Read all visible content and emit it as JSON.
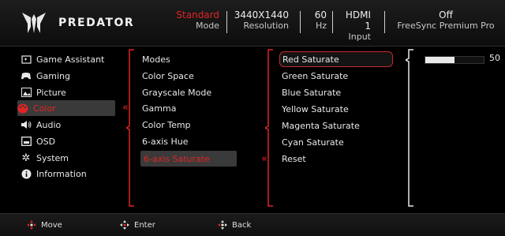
{
  "brand": {
    "name": "PREDATOR"
  },
  "status": {
    "mode": {
      "value": "Standard",
      "label": "Mode"
    },
    "resolution": {
      "value": "3440X1440",
      "label": "Resolution"
    },
    "refresh": {
      "value": "60",
      "label": "Hz"
    },
    "input": {
      "value": "HDMI 1",
      "label": "Input"
    },
    "freesync": {
      "value": "Off",
      "label": "FreeSync Premium Pro"
    }
  },
  "menu": [
    {
      "label": "Game Assistant",
      "icon": "game-assistant-icon"
    },
    {
      "label": "Gaming",
      "icon": "gamepad-icon"
    },
    {
      "label": "Picture",
      "icon": "picture-icon"
    },
    {
      "label": "Color",
      "icon": "color-palette-icon",
      "active": true
    },
    {
      "label": "Audio",
      "icon": "speaker-icon"
    },
    {
      "label": "OSD",
      "icon": "osd-icon"
    },
    {
      "label": "System",
      "icon": "gear-icon"
    },
    {
      "label": "Information",
      "icon": "info-icon"
    }
  ],
  "color_menu": [
    {
      "label": "Modes"
    },
    {
      "label": "Color Space"
    },
    {
      "label": "Grayscale Mode"
    },
    {
      "label": "Gamma"
    },
    {
      "label": "Color Temp"
    },
    {
      "label": "6-axis Hue"
    },
    {
      "label": "6-axis Saturate",
      "active": true
    }
  ],
  "saturate_menu": [
    {
      "label": "Red Saturate",
      "active": true
    },
    {
      "label": "Green Saturate"
    },
    {
      "label": "Blue Saturate"
    },
    {
      "label": "Yellow Saturate"
    },
    {
      "label": "Magenta Saturate"
    },
    {
      "label": "Cyan Saturate"
    },
    {
      "label": "Reset"
    }
  ],
  "slider": {
    "value": "50",
    "fraction": 0.5
  },
  "footer": {
    "move": "Move",
    "enter": "Enter",
    "back": "Back"
  },
  "colors": {
    "accent": "#e02424",
    "selection_bg": "#3a3a3a"
  }
}
